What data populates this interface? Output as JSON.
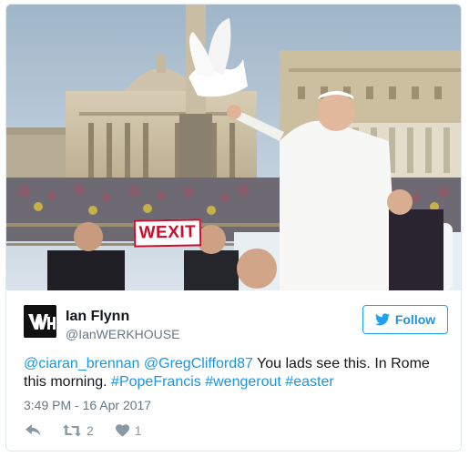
{
  "photo": {
    "sign_text": "WEXIT",
    "description_icon": "photo-image"
  },
  "author": {
    "name": "Ian Flynn",
    "handle": "@IanWERKHOUSE",
    "avatar_icon": "wh-logo-avatar"
  },
  "follow": {
    "label": "Follow",
    "icon": "twitter-bird-icon",
    "color": "#1da1f2"
  },
  "tweet": {
    "mention1": "@ciaran_brennan",
    "mention2": "@GregClifford87",
    "text_part1": " You lads see this. In Rome this morning. ",
    "hashtag1": "#PopeFrancis",
    "hashtag2": "#wengerout",
    "hashtag3": "#easter",
    "link_color": "#1b95e0"
  },
  "timestamp": "3:49 PM - 16 Apr 2017",
  "actions": {
    "reply_icon": "reply-icon",
    "retweet_icon": "retweet-icon",
    "retweet_count": "2",
    "like_icon": "heart-icon",
    "like_count": "1"
  }
}
